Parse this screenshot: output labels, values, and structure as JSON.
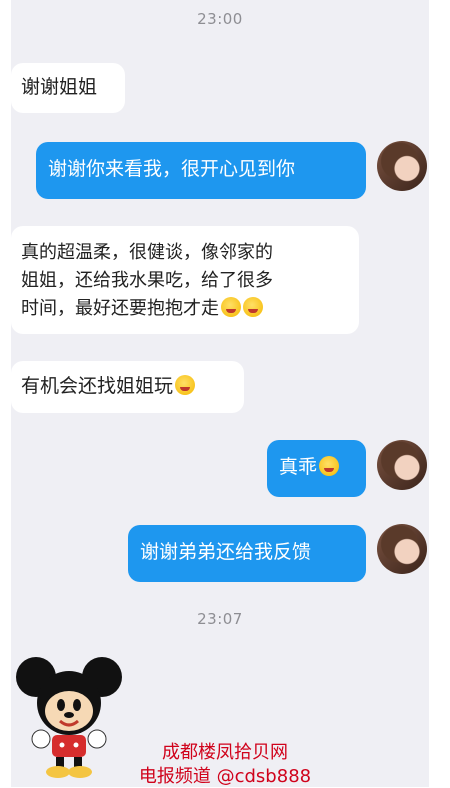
{
  "timestamps": [
    "23:00",
    "23:07"
  ],
  "messages": {
    "m1": "谢谢姐姐",
    "m2": "谢谢你来看我，很开心见到你",
    "m3_line1": "真的超温柔，很健谈，像邻家的",
    "m3_line2": "姐姐，还给我水果吃，给了很多",
    "m3_line3": "时间，最好还要抱抱才走",
    "m4": "有机会还找姐姐玩",
    "m5": "真乖",
    "m6": "谢谢弟弟还给我反馈"
  },
  "watermark": {
    "line1": "成都楼凤拾贝网",
    "line2": "电报频道 @cdsb888"
  },
  "icons": {
    "avatar": "woman-portrait-avatar",
    "emoji_hug": "hugging-face-emoji",
    "emoji_fear": "fearful-face-emoji",
    "emoji_blush": "smiling-blush-emoji",
    "sticker": "mickey-mouse-sticker"
  },
  "colors": {
    "outgoing_bubble": "#1e97ef",
    "incoming_bubble": "#ffffff",
    "chat_bg": "#efeff4",
    "watermark": "#d0021b"
  }
}
